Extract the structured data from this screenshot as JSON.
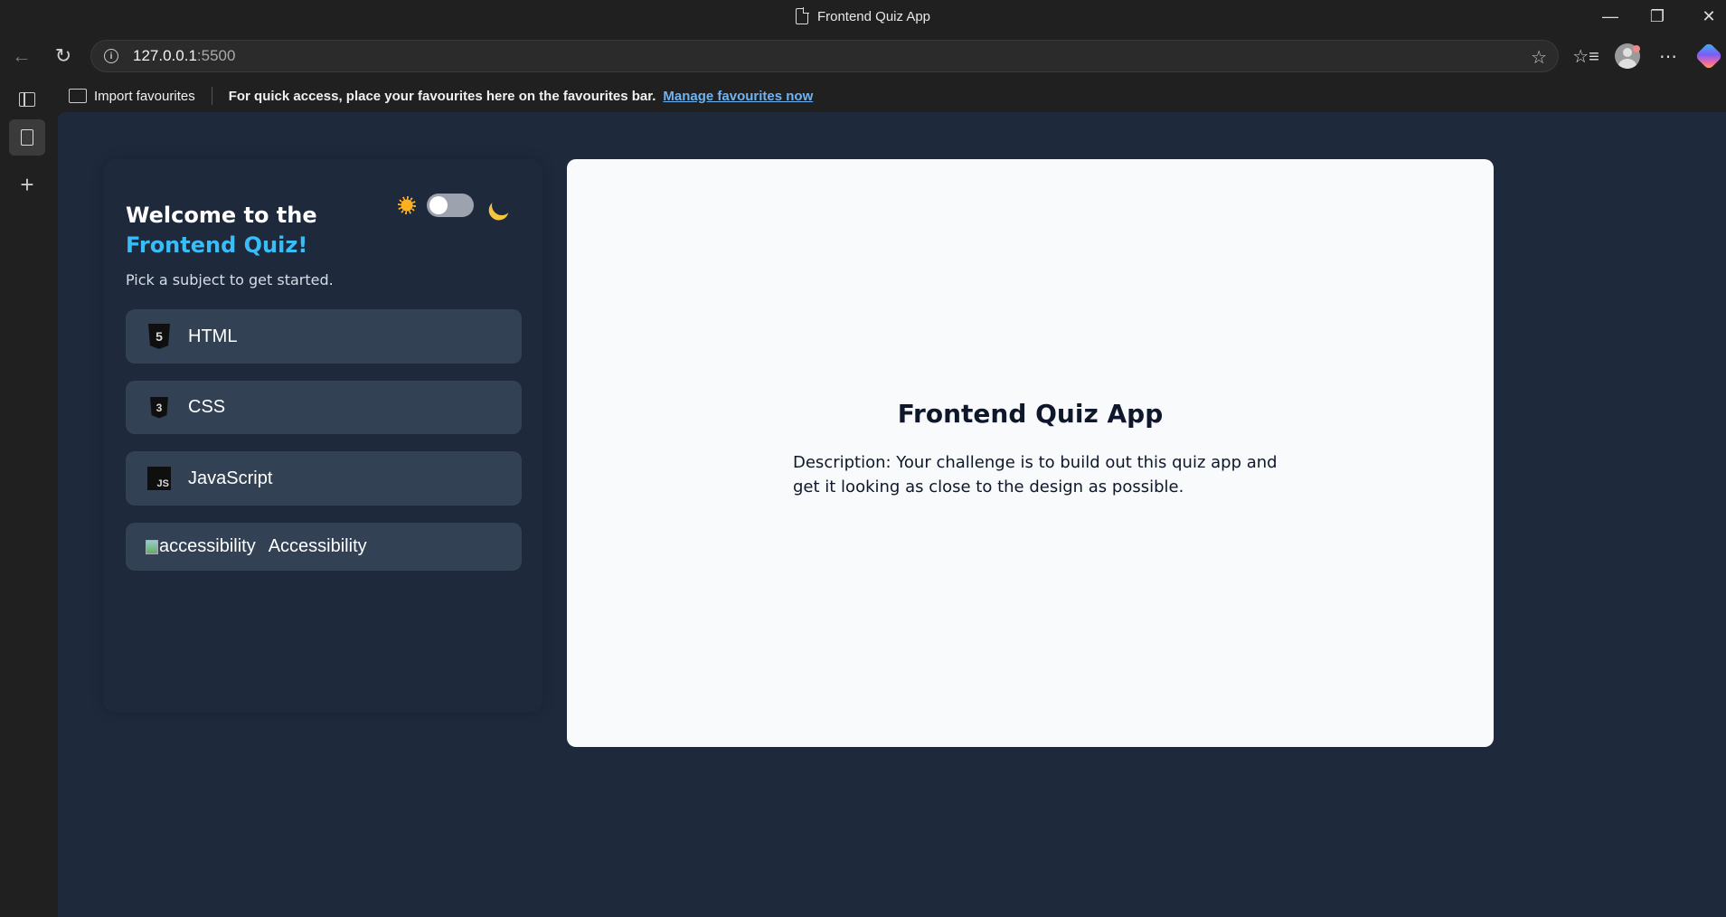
{
  "window": {
    "title": "Frontend Quiz App"
  },
  "browser": {
    "url_host": "127.0.0.1",
    "url_port": ":5500"
  },
  "favourites_bar": {
    "import_label": "Import favourites",
    "message": "For quick access, place your favourites here on the favourites bar.",
    "link": "Manage favourites now"
  },
  "sidebar": {
    "welcome_line1": "Welcome to the",
    "welcome_line2": "Frontend Quiz!",
    "subtitle": "Pick a subject to get started.",
    "subjects": [
      {
        "label": "HTML",
        "icon": "html5-icon",
        "icon_text": "5"
      },
      {
        "label": "CSS",
        "icon": "css3-icon",
        "icon_text": "3"
      },
      {
        "label": "JavaScript",
        "icon": "js-icon",
        "icon_text": "JS"
      },
      {
        "label": "Accessibility",
        "icon": "broken-image-icon",
        "alt": "accessibility"
      }
    ],
    "theme_toggle": {
      "light_icon": "sun-icon",
      "dark_icon": "moon-icon",
      "dark_enabled": false
    }
  },
  "main_card": {
    "title": "Frontend Quiz App",
    "description": "Description: Your challenge is to build out this quiz app and get it looking as close to the design as possible."
  },
  "colors": {
    "page_bg": "#1e293b",
    "subject_bg": "#334155",
    "accent": "#38bdf8",
    "card_bg": "#f8fafc"
  }
}
